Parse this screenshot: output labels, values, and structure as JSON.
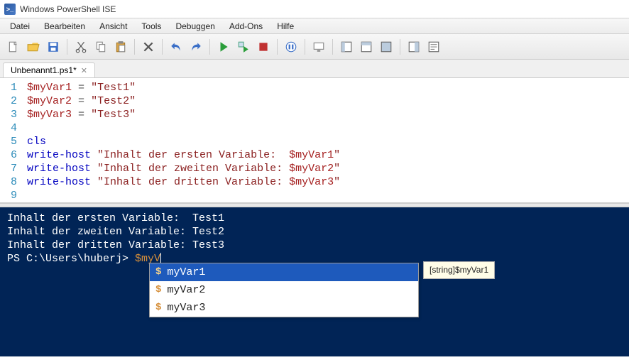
{
  "window": {
    "title": "Windows PowerShell ISE"
  },
  "menu": {
    "items": [
      "Datei",
      "Bearbeiten",
      "Ansicht",
      "Tools",
      "Debuggen",
      "Add-Ons",
      "Hilfe"
    ]
  },
  "toolbar_icons": [
    "new",
    "open",
    "save",
    "cut",
    "copy",
    "paste",
    "clear",
    "undo",
    "redo",
    "run",
    "run-selection",
    "stop",
    "debug-pause",
    "remote",
    "pane-left",
    "pane-top",
    "pane-max",
    "cmd-pane",
    "cmd-addon"
  ],
  "tab": {
    "label": "Unbenannt1.ps1*"
  },
  "editor": {
    "lines": [
      {
        "n": "1",
        "seg": [
          [
            "var",
            "$myVar1"
          ],
          [
            "txt",
            " "
          ],
          [
            "op",
            "="
          ],
          [
            "txt",
            " "
          ],
          [
            "str",
            "\"Test1\""
          ]
        ]
      },
      {
        "n": "2",
        "seg": [
          [
            "var",
            "$myVar2"
          ],
          [
            "txt",
            " "
          ],
          [
            "op",
            "="
          ],
          [
            "txt",
            " "
          ],
          [
            "str",
            "\"Test2\""
          ]
        ]
      },
      {
        "n": "3",
        "seg": [
          [
            "var",
            "$myVar3"
          ],
          [
            "txt",
            " "
          ],
          [
            "op",
            "="
          ],
          [
            "txt",
            " "
          ],
          [
            "str",
            "\"Test3\""
          ]
        ]
      },
      {
        "n": "4",
        "seg": []
      },
      {
        "n": "5",
        "seg": [
          [
            "cmd",
            "cls"
          ]
        ]
      },
      {
        "n": "6",
        "seg": [
          [
            "cmd",
            "write-host"
          ],
          [
            "txt",
            " "
          ],
          [
            "str",
            "\"Inhalt der ersten Variable:  "
          ],
          [
            "var",
            "$myVar1"
          ],
          [
            "str",
            "\""
          ]
        ]
      },
      {
        "n": "7",
        "seg": [
          [
            "cmd",
            "write-host"
          ],
          [
            "txt",
            " "
          ],
          [
            "str",
            "\"Inhalt der zweiten Variable: "
          ],
          [
            "var",
            "$myVar2"
          ],
          [
            "str",
            "\""
          ]
        ]
      },
      {
        "n": "8",
        "seg": [
          [
            "cmd",
            "write-host"
          ],
          [
            "txt",
            " "
          ],
          [
            "str",
            "\"Inhalt der dritten Variable: "
          ],
          [
            "var",
            "$myVar3"
          ],
          [
            "str",
            "\""
          ]
        ]
      },
      {
        "n": "9",
        "seg": []
      }
    ]
  },
  "console": {
    "output": [
      "Inhalt der ersten Variable:  Test1",
      "Inhalt der zweiten Variable: Test2",
      "Inhalt der dritten Variable: Test3"
    ],
    "prompt_prefix": "PS C:\\Users\\huberj> ",
    "prompt_input": "$myV"
  },
  "intellisense": {
    "items": [
      "myVar1",
      "myVar2",
      "myVar3"
    ],
    "selected_index": 0,
    "tooltip": "[string]$myVar1"
  }
}
